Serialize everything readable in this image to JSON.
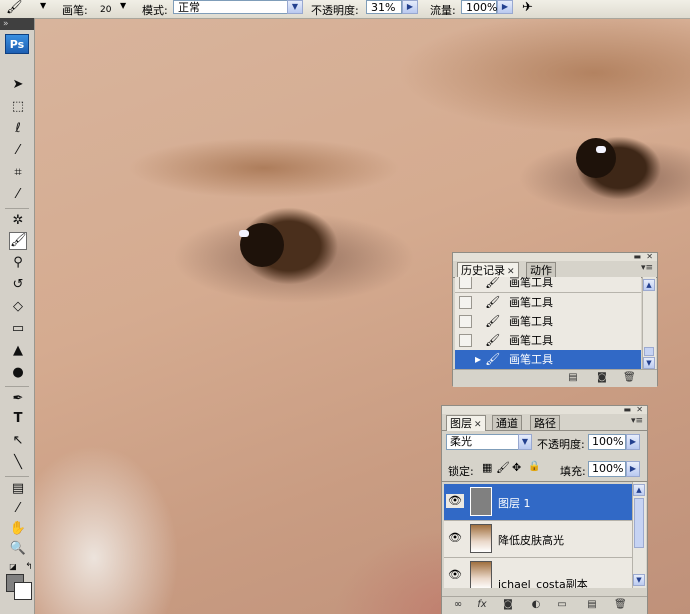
{
  "options_bar": {
    "brush_label": "画笔:",
    "brush_size": "20",
    "mode_label": "模式:",
    "mode_value": "正常",
    "opacity_label": "不透明度:",
    "opacity_value": "31%",
    "flow_label": "流量:",
    "flow_value": "100%"
  },
  "toolbox": {
    "logo": "Ps"
  },
  "history_panel": {
    "tabs": [
      {
        "label": "历史记录",
        "active": true
      },
      {
        "label": "动作",
        "active": false
      }
    ],
    "items": [
      {
        "label": "画笔工具",
        "selected": false
      },
      {
        "label": "画笔工具",
        "selected": false
      },
      {
        "label": "画笔工具",
        "selected": false
      },
      {
        "label": "画笔工具",
        "selected": false
      },
      {
        "label": "画笔工具",
        "selected": true
      }
    ]
  },
  "layers_panel": {
    "tabs": [
      {
        "label": "图层",
        "active": true
      },
      {
        "label": "通道",
        "active": false
      },
      {
        "label": "路径",
        "active": false
      }
    ],
    "blend_mode": "柔光",
    "opacity_label": "不透明度:",
    "opacity_value": "100%",
    "lock_label": "锁定:",
    "fill_label": "填充:",
    "fill_value": "100%",
    "layers": [
      {
        "name": "图层 1",
        "selected": true
      },
      {
        "name": "降低皮肤高光",
        "selected": false
      },
      {
        "name": "ichael_costa副本",
        "selected": false
      }
    ]
  },
  "colors": {
    "selection": "#3169c6",
    "panel_bg": "#d6d3ca"
  }
}
